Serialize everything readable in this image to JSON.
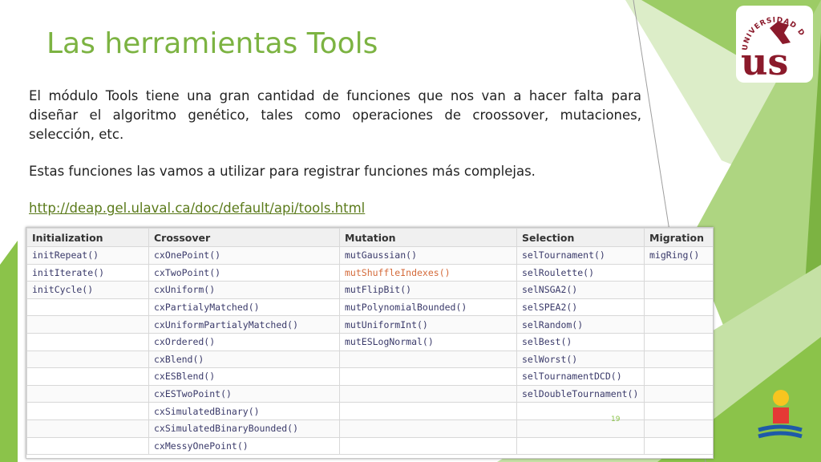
{
  "slide": {
    "title": "Las herramientas Tools",
    "paragraph1": "El módulo Tools tiene una gran cantidad de funciones que nos van a hacer falta para diseñar el algoritmo genético, tales como operaciones de croossover, mutaciones, selección, etc.",
    "paragraph2": "Estas funciones las vamos a utilizar para registrar funciones más complejas.",
    "link": "http://deap.gel.ulaval.ca/doc/default/api/tools.html",
    "page_number": "19",
    "logo_text": "UNIVERSIDAD DE SEVILLA",
    "logo_letters": "us"
  },
  "colors": {
    "title_green": "#7cb342",
    "stripe_dark": "#8bc34a",
    "stripe_light": "#c5e1a5",
    "logo_red": "#8b1a2b",
    "link_color": "#5a7a1a",
    "highlight_orange": "#d46a3a"
  },
  "icons": {
    "university_logo": "university-seal-icon",
    "corner_logo": "regional-logo-icon"
  },
  "table": {
    "headers": [
      "Initialization",
      "Crossover",
      "Mutation",
      "Selection",
      "Migration"
    ],
    "rows": [
      [
        "initRepeat()",
        "cxOnePoint()",
        "mutGaussian()",
        "selTournament()",
        "migRing()"
      ],
      [
        "initIterate()",
        "cxTwoPoint()",
        "mutShuffleIndexes()",
        "selRoulette()",
        ""
      ],
      [
        "initCycle()",
        "cxUniform()",
        "mutFlipBit()",
        "selNSGA2()",
        ""
      ],
      [
        "",
        "cxPartialyMatched()",
        "mutPolynomialBounded()",
        "selSPEA2()",
        ""
      ],
      [
        "",
        "cxUniformPartialyMatched()",
        "mutUniformInt()",
        "selRandom()",
        ""
      ],
      [
        "",
        "cxOrdered()",
        "mutESLogNormal()",
        "selBest()",
        ""
      ],
      [
        "",
        "cxBlend()",
        "",
        "selWorst()",
        ""
      ],
      [
        "",
        "cxESBlend()",
        "",
        "selTournamentDCD()",
        ""
      ],
      [
        "",
        "cxESTwoPoint()",
        "",
        "selDoubleTournament()",
        ""
      ],
      [
        "",
        "cxSimulatedBinary()",
        "",
        "",
        ""
      ],
      [
        "",
        "cxSimulatedBinaryBounded()",
        "",
        "",
        ""
      ],
      [
        "",
        "cxMessyOnePoint()",
        "",
        "",
        ""
      ]
    ]
  }
}
